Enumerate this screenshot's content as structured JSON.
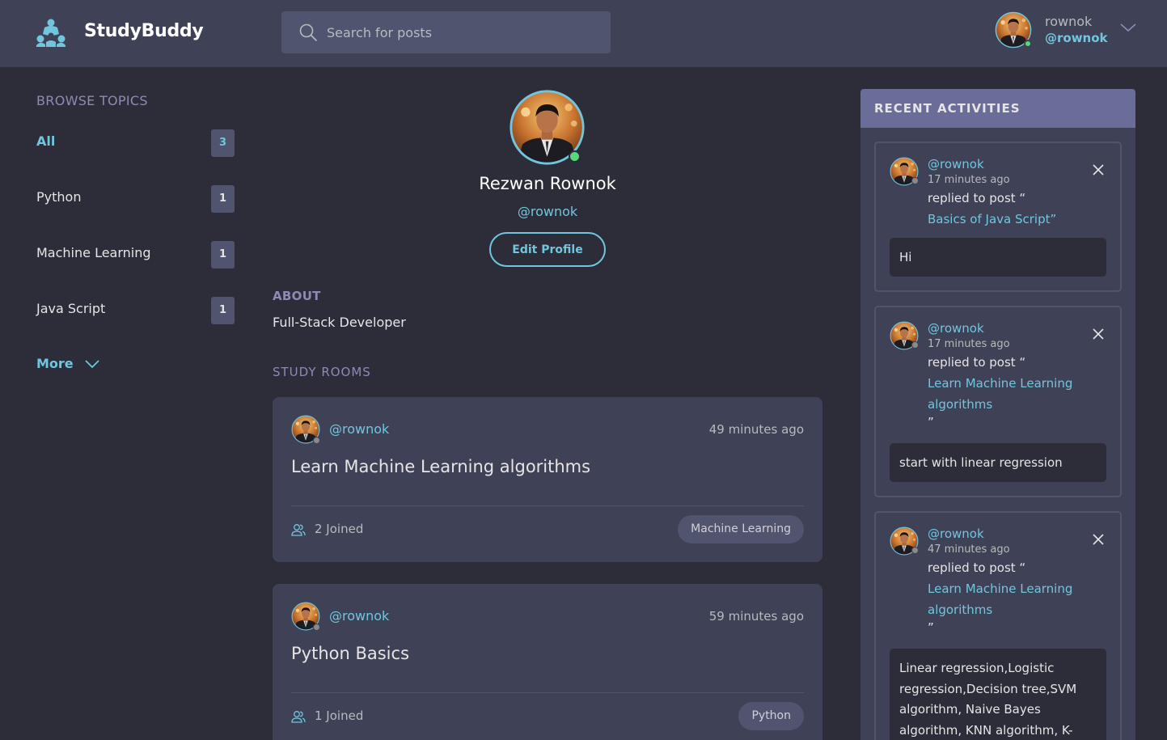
{
  "app": {
    "name": "StudyBuddy"
  },
  "search": {
    "placeholder": "Search for posts"
  },
  "user": {
    "name": "rownok",
    "handle": "@rownok"
  },
  "sidebar": {
    "title": "BROWSE TOPICS",
    "topics": [
      {
        "label": "All",
        "count": "3",
        "active": true
      },
      {
        "label": "Python",
        "count": "1"
      },
      {
        "label": "Machine Learning",
        "count": "1"
      },
      {
        "label": "Java Script",
        "count": "1"
      }
    ],
    "more_label": "More"
  },
  "profile": {
    "name": "Rezwan Rownok",
    "handle": "@rownok",
    "edit_label": "Edit Profile",
    "about_title": "ABOUT",
    "about_text": "Full-Stack Developer",
    "rooms_title": "STUDY ROOMS"
  },
  "rooms": [
    {
      "host": "@rownok",
      "time": "49 minutes ago",
      "title": "Learn Machine Learning algorithms",
      "joined": "2 Joined",
      "topic": "Machine Learning"
    },
    {
      "host": "@rownok",
      "time": "59 minutes ago",
      "title": "Python Basics",
      "joined": "1 Joined",
      "topic": "Python"
    }
  ],
  "activities": {
    "title": "RECENT ACTIVITIES",
    "items": [
      {
        "user": "@rownok",
        "time": "17 minutes ago",
        "action": "replied to post “",
        "post": "Basics of Java Script”",
        "quote_close": "",
        "message": "Hi"
      },
      {
        "user": "@rownok",
        "time": "17 minutes ago",
        "action": "replied to post “",
        "post": "Learn Machine Learning algorithms",
        "quote_close": "”",
        "message": "start with linear regression"
      },
      {
        "user": "@rownok",
        "time": "47 minutes ago",
        "action": "replied to post “",
        "post": "Learn Machine Learning algorithms",
        "quote_close": "”",
        "message": "Linear regression,Logistic regression,Decision tree,SVM algorithm, Naive Bayes algorithm, KNN algorithm, K-means, Random"
      }
    ]
  },
  "colors": {
    "accent": "#71c6dd",
    "bg": "#2d2d39",
    "panel": "#3f4156",
    "online": "#59d87a",
    "offline": "#8a8a8a"
  }
}
